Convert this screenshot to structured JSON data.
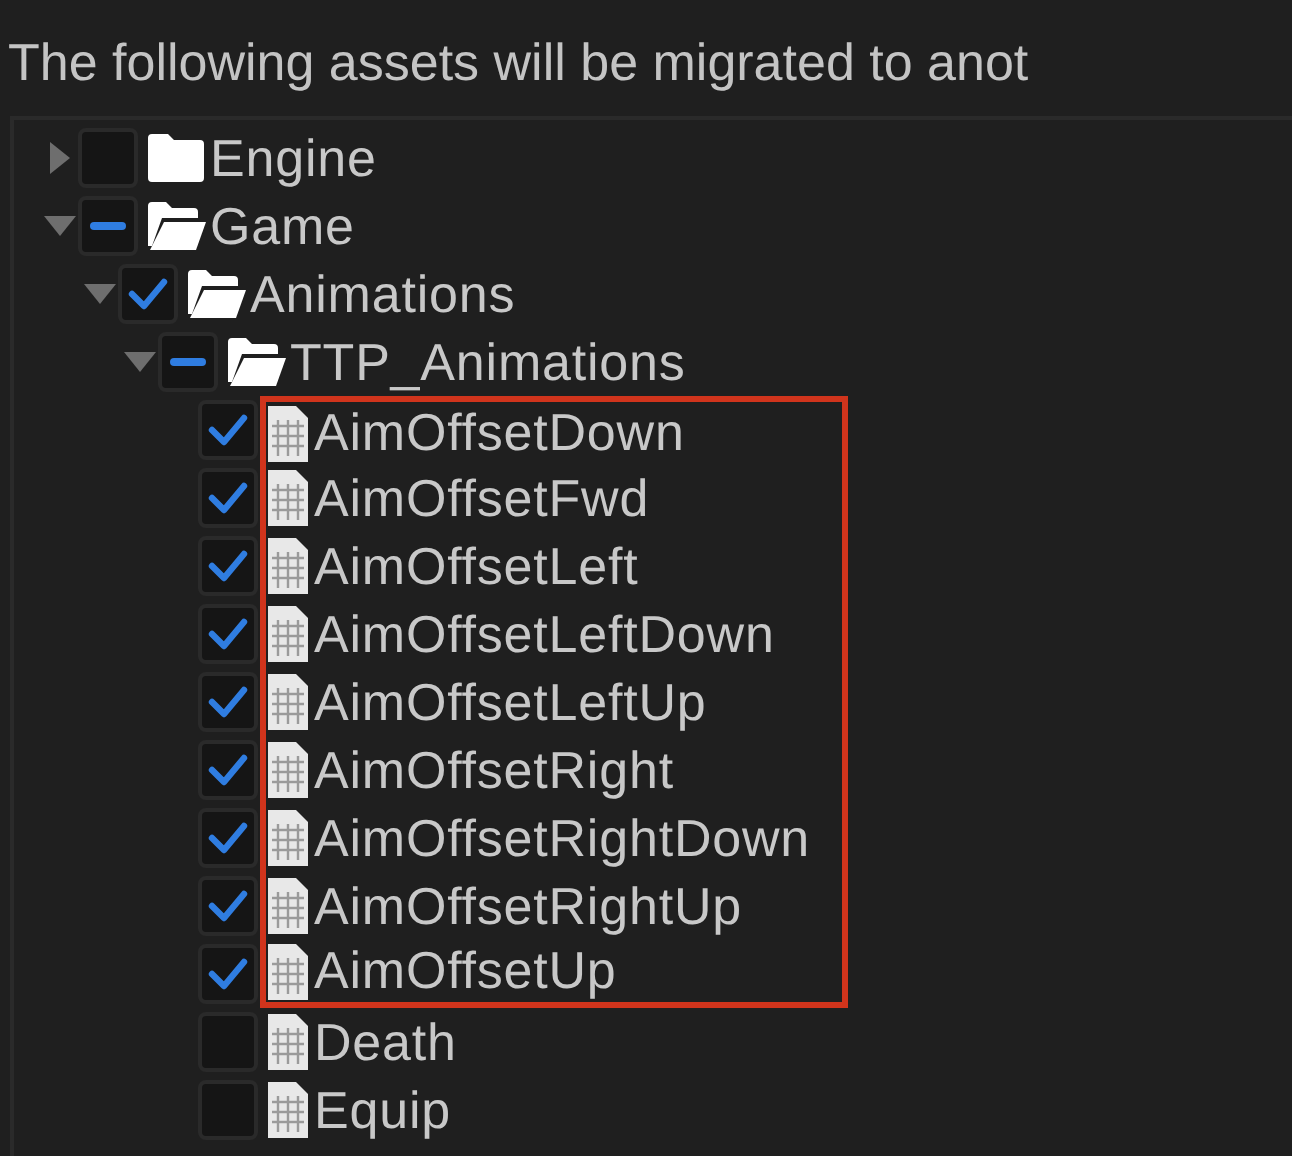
{
  "message": "The following assets will be migrated to anot",
  "tree": [
    {
      "label": "Engine",
      "kind": "folder",
      "expanded": false,
      "checked": false,
      "highlighted": false
    },
    {
      "label": "Game",
      "kind": "folder",
      "expanded": true,
      "mixed": true,
      "highlighted": false,
      "children": [
        {
          "label": "Animations",
          "kind": "folder",
          "expanded": true,
          "checked": true,
          "highlighted": false,
          "children": [
            {
              "label": "TTP_Animations",
              "kind": "folder",
              "expanded": true,
              "mixed": true,
              "highlighted": false,
              "children": [
                {
                  "label": "AimOffsetDown",
                  "kind": "asset",
                  "checked": true,
                  "highlighted": true
                },
                {
                  "label": "AimOffsetFwd",
                  "kind": "asset",
                  "checked": true,
                  "highlighted": true
                },
                {
                  "label": "AimOffsetLeft",
                  "kind": "asset",
                  "checked": true,
                  "highlighted": true
                },
                {
                  "label": "AimOffsetLeftDown",
                  "kind": "asset",
                  "checked": true,
                  "highlighted": true
                },
                {
                  "label": "AimOffsetLeftUp",
                  "kind": "asset",
                  "checked": true,
                  "highlighted": true
                },
                {
                  "label": "AimOffsetRight",
                  "kind": "asset",
                  "checked": true,
                  "highlighted": true
                },
                {
                  "label": "AimOffsetRightDown",
                  "kind": "asset",
                  "checked": true,
                  "highlighted": true
                },
                {
                  "label": "AimOffsetRightUp",
                  "kind": "asset",
                  "checked": true,
                  "highlighted": true
                },
                {
                  "label": "AimOffsetUp",
                  "kind": "asset",
                  "checked": true,
                  "highlighted": true
                },
                {
                  "label": "Death",
                  "kind": "asset",
                  "checked": false,
                  "highlighted": false
                },
                {
                  "label": "Equip",
                  "kind": "asset",
                  "checked": false,
                  "highlighted": false
                }
              ]
            }
          ]
        }
      ]
    }
  ]
}
